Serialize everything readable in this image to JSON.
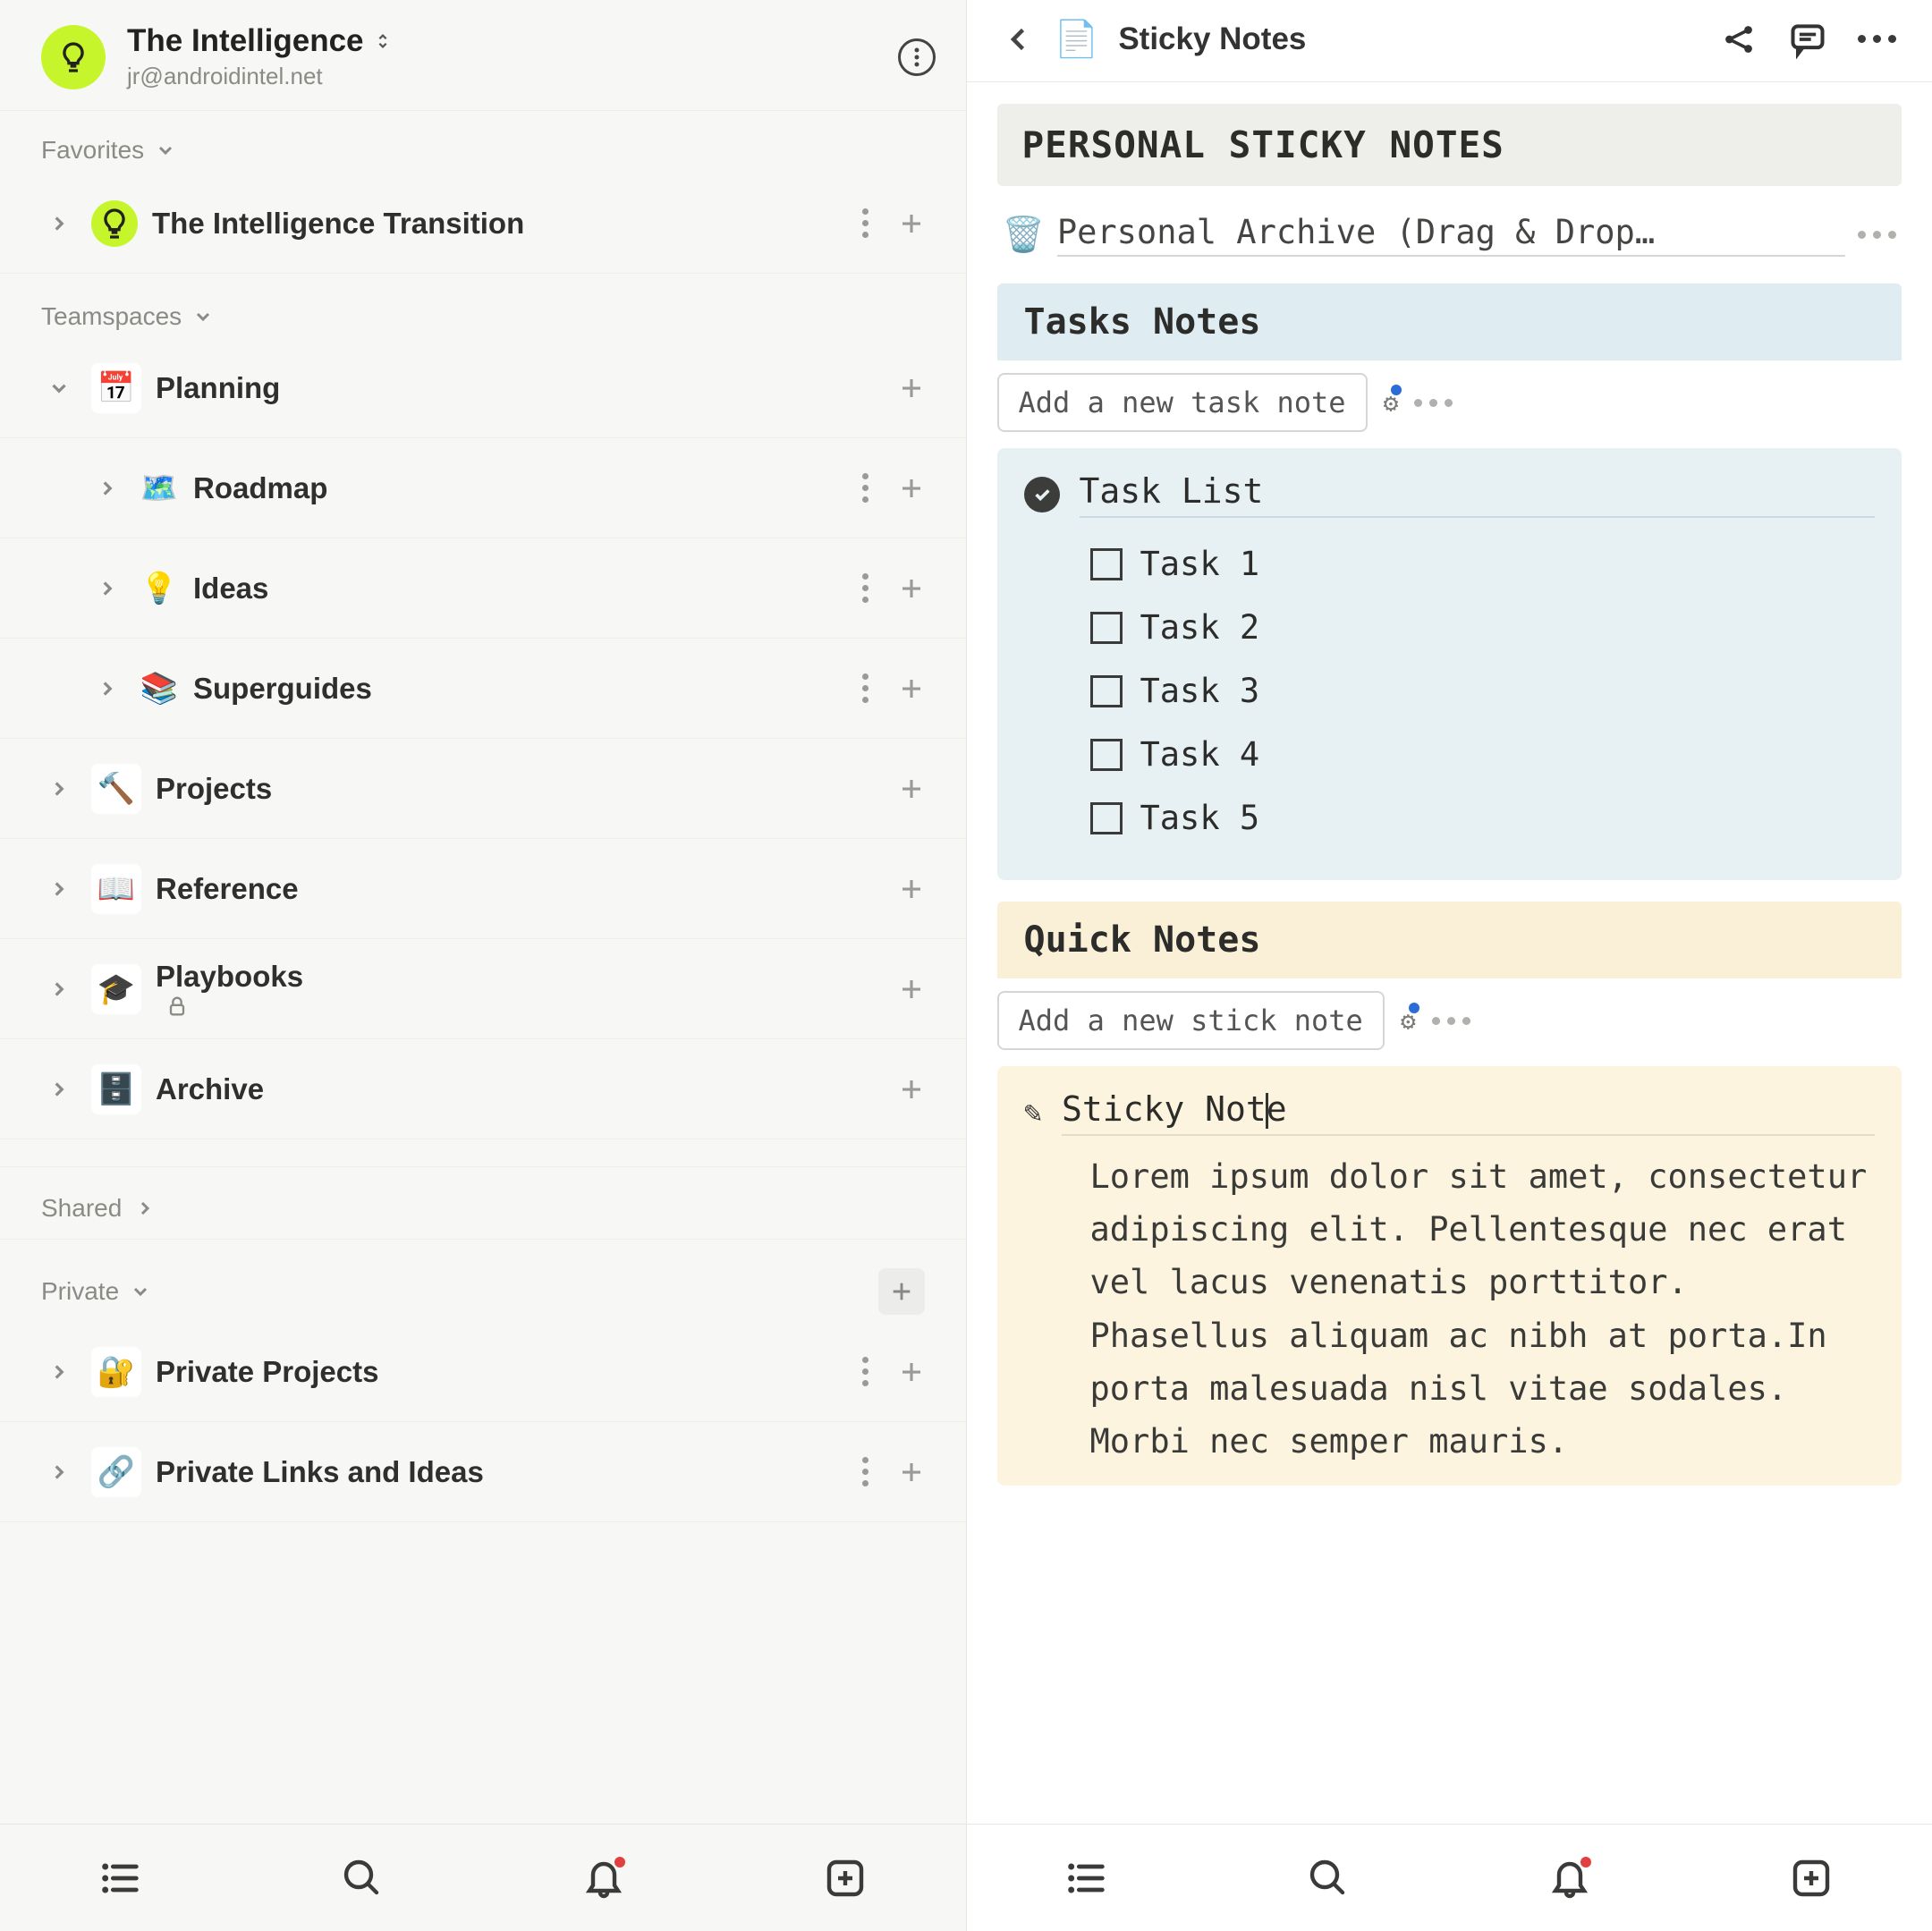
{
  "workspace": {
    "title": "The Intelligence",
    "email": "jr@androidintel.net"
  },
  "sections": {
    "favorites": "Favorites",
    "teamspaces": "Teamspaces",
    "shared": "Shared",
    "private": "Private"
  },
  "favorites": [
    {
      "icon": "💡",
      "label": "The Intelligence Transition"
    }
  ],
  "teamspaces": [
    {
      "icon": "📅",
      "label": "Planning",
      "expanded": true,
      "children": [
        {
          "icon": "🗺️",
          "label": "Roadmap"
        },
        {
          "icon": "💡",
          "label": "Ideas"
        },
        {
          "icon": "📚",
          "label": "Superguides"
        }
      ]
    },
    {
      "icon": "🔨",
      "label": "Projects"
    },
    {
      "icon": "📖",
      "label": "Reference"
    },
    {
      "icon": "🎓",
      "label": "Playbooks",
      "locked": true
    },
    {
      "icon": "🗄️",
      "label": "Archive"
    }
  ],
  "private": [
    {
      "icon": "🔐",
      "label": "Private Projects"
    },
    {
      "icon": "🔗",
      "label": "Private Links and Ideas"
    }
  ],
  "doc": {
    "title": "Sticky Notes",
    "icon": "📄",
    "heading": "PERSONAL STICKY NOTES",
    "archive_icon": "🗑️",
    "archive_text": "Personal Archive (Drag & Drop…",
    "tasks": {
      "heading": "Tasks Notes",
      "add_label": "Add a new task note",
      "card_title": "Task List",
      "items": [
        "Task 1",
        "Task 2",
        "Task 3",
        "Task 4",
        "Task 5"
      ]
    },
    "quick": {
      "heading": "Quick Notes",
      "add_label": "Add a new stick note",
      "note_title": "Sticky Note",
      "note_body": "Lorem ipsum dolor sit amet, consectetur adipiscing elit. Pellentesque nec erat vel lacus venenatis porttitor. Phasellus aliquam ac nibh at porta.In porta malesuada nisl vitae sodales. Morbi nec semper mauris."
    }
  }
}
